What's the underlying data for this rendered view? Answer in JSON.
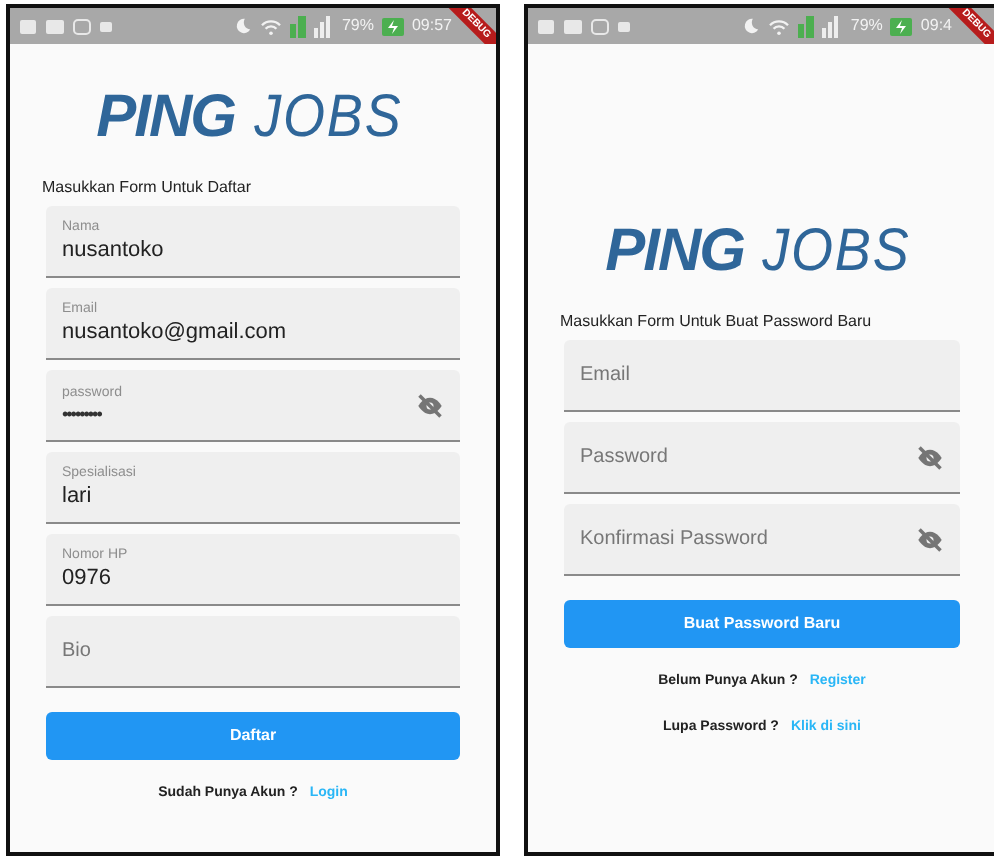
{
  "screens": [
    {
      "status": {
        "battery": "79%",
        "time": "09:57"
      },
      "banner": "DEBUG",
      "logo": {
        "bold": "PING",
        "light": "JOBS"
      },
      "heading": "Masukkan Form Untuk Daftar",
      "fields": [
        {
          "label": "Nama",
          "value": "nusantoko",
          "toggle": false
        },
        {
          "label": "Email",
          "value": "nusantoko@gmail.com",
          "toggle": false
        },
        {
          "label": "password",
          "value": "•••••••••",
          "toggle": true
        },
        {
          "label": "Spesialisasi",
          "value": "lari",
          "toggle": false
        },
        {
          "label": "Nomor HP",
          "value": "0976",
          "toggle": false
        },
        {
          "placeholder": "Bio",
          "toggle": false
        }
      ],
      "button": "Daftar",
      "links": [
        {
          "text": "Sudah Punya Akun ?",
          "link": "Login"
        }
      ]
    },
    {
      "status": {
        "battery": "79%",
        "time": "09:4"
      },
      "banner": "DEBUG",
      "logo": {
        "bold": "PING",
        "light": "JOBS"
      },
      "heading": "Masukkan Form Untuk Buat Password Baru",
      "fields": [
        {
          "placeholder": "Email",
          "toggle": false
        },
        {
          "placeholder": "Password",
          "toggle": true
        },
        {
          "placeholder": "Konfirmasi Password",
          "toggle": true
        }
      ],
      "button": "Buat Password Baru",
      "links": [
        {
          "text": "Belum Punya Akun ?",
          "link": "Register"
        },
        {
          "text": "Lupa Password  ?",
          "link": "Klik di sini"
        }
      ]
    }
  ]
}
